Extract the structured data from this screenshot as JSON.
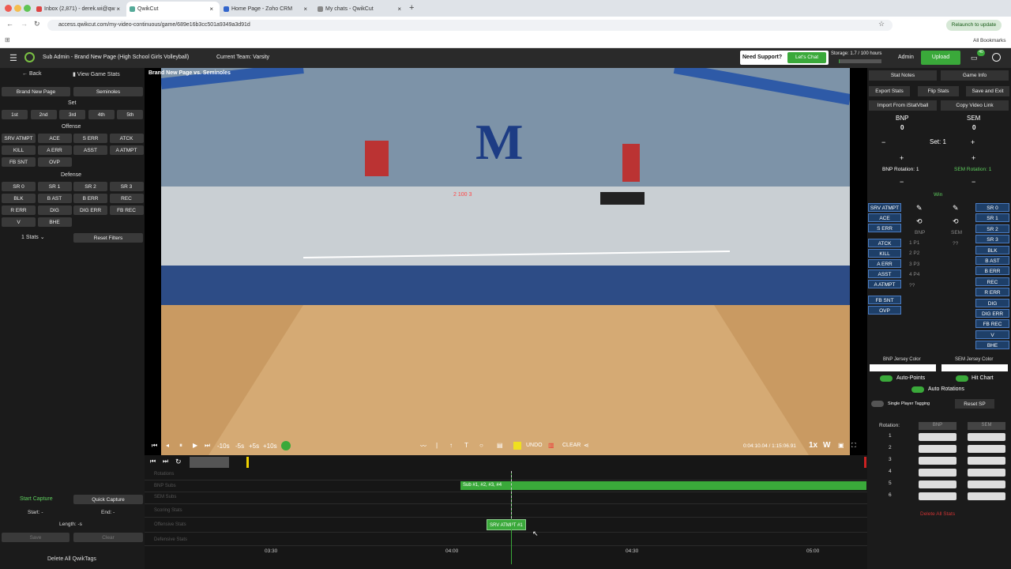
{
  "browser": {
    "tabs": [
      {
        "label": "Inbox (2,871) - derek.wi@qw"
      },
      {
        "label": "QwikCut"
      },
      {
        "label": "Home Page - Zoho CRM"
      },
      {
        "label": "My chats - QwikCut"
      }
    ],
    "url": "access.qwikcut.com/my-video-continuous/game/689e16b3cc501a9349a3d91d",
    "relaunch": "Relaunch to update",
    "all_bookmarks": "All Bookmarks"
  },
  "header": {
    "title": "Sub Admin - Brand New Page (High School Girls Volleyball)",
    "team": "Current Team: Varsity",
    "need_support": "Need Support?",
    "lets_chat": "Let's Chat",
    "storage": "Storage: 1.7 / 100 hours",
    "storage_used": 0.017,
    "admin": "Admin",
    "upload": "Upload",
    "notif_count": "40"
  },
  "left": {
    "back": "Back",
    "view_game_stats": "View Game Stats",
    "team_a": "Brand New Page",
    "team_b": "Seminoles",
    "set_label": "Set",
    "sets": [
      "1st",
      "2nd",
      "3rd",
      "4th",
      "5th"
    ],
    "offense_label": "Offense",
    "offense": [
      "SRV ATMPT",
      "ACE",
      "S ERR",
      "ATCK",
      "KILL",
      "A ERR",
      "ASST",
      "A ATMPT",
      "FB SNT",
      "OVP"
    ],
    "defense_label": "Defense",
    "defense": [
      "SR 0",
      "SR 1",
      "SR 2",
      "SR 3",
      "BLK",
      "B AST",
      "B ERR",
      "REC",
      "R ERR",
      "DIG",
      "DIG ERR",
      "FB REC",
      "V",
      "BHE"
    ],
    "stats_select": "1 Stats",
    "reset_filters": "Reset Filters",
    "start_capture": "Start Capture",
    "quick_capture": "Quick Capture",
    "start": "Start: -",
    "end": "End: -",
    "length": "Length: -s",
    "save": "Save",
    "clear": "Clear",
    "delete_all": "Delete All QwikTags"
  },
  "video": {
    "title": "Brand New Page vs. Seminoles",
    "skip_back": "-10s",
    "skip_b5": "-5s",
    "skip_f5": "+5s",
    "skip_f10": "+10s",
    "undo": "UNDO",
    "clear": "CLEAR",
    "time": "0:04:10.04 / 1:15:06.91",
    "speed": "1x",
    "scoreboard": "2 100 3"
  },
  "timeline": {
    "tracks": [
      "Rotations",
      "BNP Subs",
      "SEM Subs",
      "Scoring Stats",
      "Offensive Stats",
      "Defensive Stats"
    ],
    "sub_clip": "Sub #1, #2, #3, #4",
    "srv_clip": "SRV ATMPT #1",
    "ticks": [
      "03:30",
      "04:00",
      "04:30",
      "05:00"
    ]
  },
  "right": {
    "stat_notes": "Stat Notes",
    "game_info": "Game Info",
    "export_stats": "Export Stats",
    "flip_stats": "Flip Stats",
    "save_exit": "Save and Exit",
    "import": "Import From iStatVball",
    "copy_link": "Copy Video Link",
    "team_a": "BNP",
    "team_b": "SEM",
    "score_a": "0",
    "score_b": "0",
    "minus": "−",
    "plus": "+",
    "set": "Set: 1",
    "rot_a": "BNP Rotation: 1",
    "rot_b": "SEM Rotation: 1",
    "win": "Win",
    "left_stats": [
      "SRV ATMPT",
      "ACE",
      "S ERR",
      "ATCK",
      "KILL",
      "A ERR",
      "ASST",
      "A ATMPT",
      "FB SNT",
      "OVP"
    ],
    "bnp_label": "BNP",
    "sem_label": "SEM",
    "players": [
      "1 P1",
      "2 P2",
      "3 P3",
      "4 P4",
      "??"
    ],
    "sem_players": [
      "??"
    ],
    "right_stats": [
      "SR 0",
      "SR 1",
      "SR 2",
      "SR 3",
      "BLK",
      "B AST",
      "B ERR",
      "REC",
      "R ERR",
      "DIG",
      "DIG ERR",
      "FB REC",
      "V",
      "BHE"
    ],
    "bnp_jersey": "BNP Jersey Color",
    "sem_jersey": "SEM Jersey Color",
    "auto_points": "Auto-Points",
    "hit_chart": "Hit Chart",
    "auto_rotations": "Auto Rotations",
    "single_player": "Single Player Tagging",
    "reset_sp": "Reset SP",
    "rotation": "Rotation:",
    "rot_rows": [
      "1",
      "2",
      "3",
      "4",
      "5",
      "6"
    ],
    "delete_all_stats": "Delete All Stats"
  },
  "colors": {
    "accent": "#3aa93a",
    "stat_blue": "#1e3f68"
  }
}
